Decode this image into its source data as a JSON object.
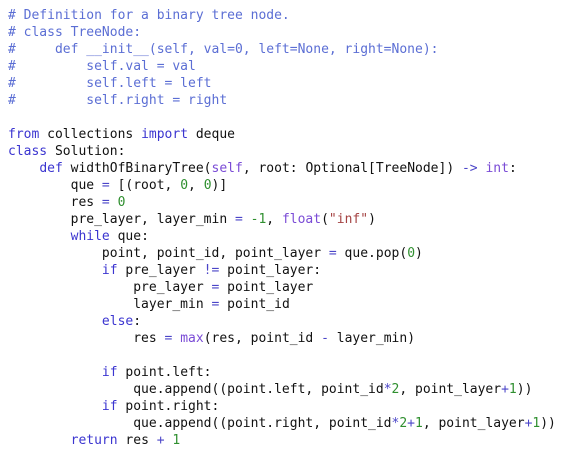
{
  "editor": {
    "lines": [
      [
        {
          "t": "# Definition for a binary tree node.",
          "c": "comment"
        }
      ],
      [
        {
          "t": "# class TreeNode:",
          "c": "comment"
        }
      ],
      [
        {
          "t": "#     def __init__(self, val=0, left=None, right=None):",
          "c": "comment"
        }
      ],
      [
        {
          "t": "#         self.val = val",
          "c": "comment"
        }
      ],
      [
        {
          "t": "#         self.left = left",
          "c": "comment"
        }
      ],
      [
        {
          "t": "#         self.right = right",
          "c": "comment"
        }
      ],
      [],
      [
        {
          "t": "from",
          "c": "keyword"
        },
        {
          "t": " collections ",
          "c": "plain"
        },
        {
          "t": "import",
          "c": "keyword"
        },
        {
          "t": " deque",
          "c": "plain"
        }
      ],
      [
        {
          "t": "class",
          "c": "keyword"
        },
        {
          "t": " Solution:",
          "c": "plain"
        }
      ],
      [
        {
          "t": "    ",
          "c": "plain"
        },
        {
          "t": "def",
          "c": "keyword"
        },
        {
          "t": " widthOfBinaryTree(",
          "c": "plain"
        },
        {
          "t": "self",
          "c": "builtin"
        },
        {
          "t": ", root: Optional[TreeNode]) ",
          "c": "plain"
        },
        {
          "t": "->",
          "c": "operator"
        },
        {
          "t": " ",
          "c": "plain"
        },
        {
          "t": "int",
          "c": "builtin"
        },
        {
          "t": ":",
          "c": "plain"
        }
      ],
      [
        {
          "t": "        que ",
          "c": "plain"
        },
        {
          "t": "=",
          "c": "operator"
        },
        {
          "t": " [(root, ",
          "c": "plain"
        },
        {
          "t": "0",
          "c": "number"
        },
        {
          "t": ", ",
          "c": "plain"
        },
        {
          "t": "0",
          "c": "number"
        },
        {
          "t": ")]",
          "c": "plain"
        }
      ],
      [
        {
          "t": "        res ",
          "c": "plain"
        },
        {
          "t": "=",
          "c": "operator"
        },
        {
          "t": " ",
          "c": "plain"
        },
        {
          "t": "0",
          "c": "number"
        }
      ],
      [
        {
          "t": "        pre_layer, layer_min ",
          "c": "plain"
        },
        {
          "t": "=",
          "c": "operator"
        },
        {
          "t": " ",
          "c": "plain"
        },
        {
          "t": "-1",
          "c": "number"
        },
        {
          "t": ", ",
          "c": "plain"
        },
        {
          "t": "float",
          "c": "builtin"
        },
        {
          "t": "(",
          "c": "plain"
        },
        {
          "t": "\"inf\"",
          "c": "string"
        },
        {
          "t": ")",
          "c": "plain"
        }
      ],
      [
        {
          "t": "        ",
          "c": "plain"
        },
        {
          "t": "while",
          "c": "keyword"
        },
        {
          "t": " que:",
          "c": "plain"
        }
      ],
      [
        {
          "t": "            point, point_id, point_layer ",
          "c": "plain"
        },
        {
          "t": "=",
          "c": "operator"
        },
        {
          "t": " que.pop(",
          "c": "plain"
        },
        {
          "t": "0",
          "c": "number"
        },
        {
          "t": ")",
          "c": "plain"
        }
      ],
      [
        {
          "t": "            ",
          "c": "plain"
        },
        {
          "t": "if",
          "c": "keyword"
        },
        {
          "t": " pre_layer ",
          "c": "plain"
        },
        {
          "t": "!=",
          "c": "operator"
        },
        {
          "t": " point_layer:",
          "c": "plain"
        }
      ],
      [
        {
          "t": "                pre_layer ",
          "c": "plain"
        },
        {
          "t": "=",
          "c": "operator"
        },
        {
          "t": " point_layer",
          "c": "plain"
        }
      ],
      [
        {
          "t": "                layer_min ",
          "c": "plain"
        },
        {
          "t": "=",
          "c": "operator"
        },
        {
          "t": " point_id",
          "c": "plain"
        }
      ],
      [
        {
          "t": "            ",
          "c": "plain"
        },
        {
          "t": "else",
          "c": "keyword"
        },
        {
          "t": ":",
          "c": "plain"
        }
      ],
      [
        {
          "t": "                res ",
          "c": "plain"
        },
        {
          "t": "=",
          "c": "operator"
        },
        {
          "t": " ",
          "c": "plain"
        },
        {
          "t": "max",
          "c": "builtin"
        },
        {
          "t": "(res, point_id ",
          "c": "plain"
        },
        {
          "t": "-",
          "c": "operator"
        },
        {
          "t": " layer_min)",
          "c": "plain"
        }
      ],
      [],
      [
        {
          "t": "            ",
          "c": "plain"
        },
        {
          "t": "if",
          "c": "keyword"
        },
        {
          "t": " point.left:",
          "c": "plain"
        }
      ],
      [
        {
          "t": "                que.append((point.left, point_id",
          "c": "plain"
        },
        {
          "t": "*",
          "c": "operator"
        },
        {
          "t": "2",
          "c": "number"
        },
        {
          "t": ", point_layer",
          "c": "plain"
        },
        {
          "t": "+",
          "c": "operator"
        },
        {
          "t": "1",
          "c": "number"
        },
        {
          "t": "))",
          "c": "plain"
        }
      ],
      [
        {
          "t": "            ",
          "c": "plain"
        },
        {
          "t": "if",
          "c": "keyword"
        },
        {
          "t": " point.right:",
          "c": "plain"
        }
      ],
      [
        {
          "t": "                que.append((point.right, point_id",
          "c": "plain"
        },
        {
          "t": "*",
          "c": "operator"
        },
        {
          "t": "2",
          "c": "number"
        },
        {
          "t": "+",
          "c": "operator"
        },
        {
          "t": "1",
          "c": "number"
        },
        {
          "t": ", point_layer",
          "c": "plain"
        },
        {
          "t": "+",
          "c": "operator"
        },
        {
          "t": "1",
          "c": "number"
        },
        {
          "t": "))",
          "c": "plain"
        }
      ],
      [
        {
          "t": "        ",
          "c": "plain"
        },
        {
          "t": "return",
          "c": "keyword"
        },
        {
          "t": " res ",
          "c": "plain"
        },
        {
          "t": "+",
          "c": "operator"
        },
        {
          "t": " ",
          "c": "plain"
        },
        {
          "t": "1",
          "c": "number"
        }
      ]
    ]
  }
}
